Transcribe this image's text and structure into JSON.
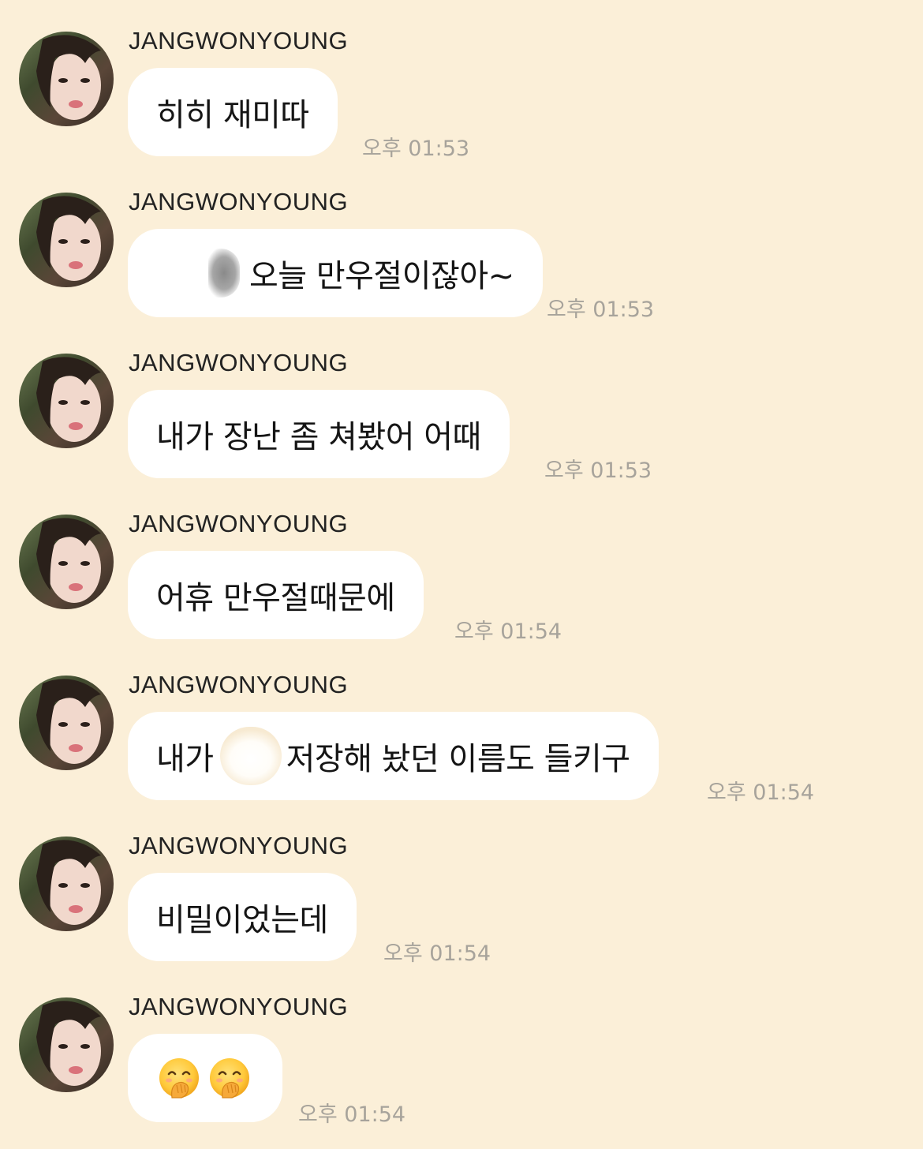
{
  "messages": [
    {
      "sender": "JANGWONYOUNG",
      "text": "히히 재미따",
      "time": "오후 01:53"
    },
    {
      "sender": "JANGWONYOUNG",
      "text": "오늘 만우절이잖아~",
      "time": "오후 01:53"
    },
    {
      "sender": "JANGWONYOUNG",
      "text": "내가 장난 좀 쳐봤어 어때",
      "time": "오후 01:53"
    },
    {
      "sender": "JANGWONYOUNG",
      "text": "어휴 만우절때문에",
      "time": "오후 01:54"
    },
    {
      "sender": "JANGWONYOUNG",
      "text_before": "내가",
      "text_after": "저장해 놨던 이름도 들키구",
      "time": "오후 01:54"
    },
    {
      "sender": "JANGWONYOUNG",
      "text": "비밀이었는데",
      "time": "오후 01:54"
    },
    {
      "sender": "JANGWONYOUNG",
      "emojis": [
        "face-with-hand-over-mouth",
        "face-with-hand-over-mouth"
      ],
      "time": "오후 01:54"
    }
  ],
  "colors": {
    "background": "#fbefd8",
    "bubble": "#ffffff",
    "timestamp": "#a7a39b"
  }
}
